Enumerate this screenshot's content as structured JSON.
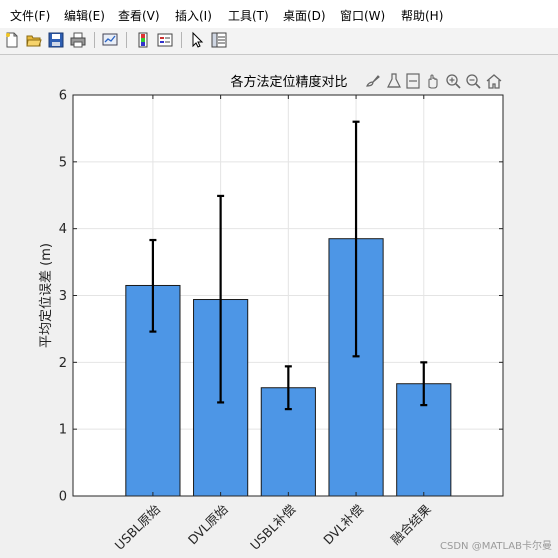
{
  "menu": {
    "items": [
      {
        "label": "文件(F)"
      },
      {
        "label": "编辑(E)"
      },
      {
        "label": "查看(V)"
      },
      {
        "label": "插入(I)"
      },
      {
        "label": "工具(T)"
      },
      {
        "label": "桌面(D)"
      },
      {
        "label": "窗口(W)"
      },
      {
        "label": "帮助(H)"
      }
    ]
  },
  "toolbar": {
    "icons": [
      "new-figure-icon",
      "open-file-icon",
      "save-icon",
      "print-icon",
      "link-plot-icon",
      "insert-colorbar-icon",
      "insert-legend-icon",
      "edit-plot-icon",
      "property-inspector-icon"
    ]
  },
  "axes_toolbar": {
    "icons": [
      "brush-icon",
      "data-tips-icon",
      "restore-view-icon",
      "pan-icon",
      "zoom-in-icon",
      "zoom-out-icon",
      "home-icon"
    ]
  },
  "watermark": "CSDN @MATLAB卡尔曼",
  "colors": {
    "bar_fill": "#4d96e6",
    "bar_edge": "#1a1a1a",
    "errorbar": "#000000",
    "grid": "#e4e4e4",
    "axes_bg": "#ffffff"
  },
  "chart_data": {
    "type": "bar",
    "title": "各方法定位精度对比",
    "xlabel": "",
    "ylabel": "平均定位误差 (m)",
    "categories": [
      "USBL原始",
      "DVL原始",
      "USBL补偿",
      "DVL补偿",
      "融合结果"
    ],
    "values": [
      3.15,
      2.94,
      1.62,
      3.85,
      1.68
    ],
    "error_low": [
      2.46,
      1.4,
      1.3,
      2.09,
      1.36
    ],
    "error_high": [
      3.83,
      4.49,
      1.94,
      5.6,
      2.0
    ],
    "ylim": [
      0,
      6
    ],
    "yticks": [
      0,
      1,
      2,
      3,
      4,
      5,
      6
    ],
    "grid": true,
    "legend": "none"
  }
}
